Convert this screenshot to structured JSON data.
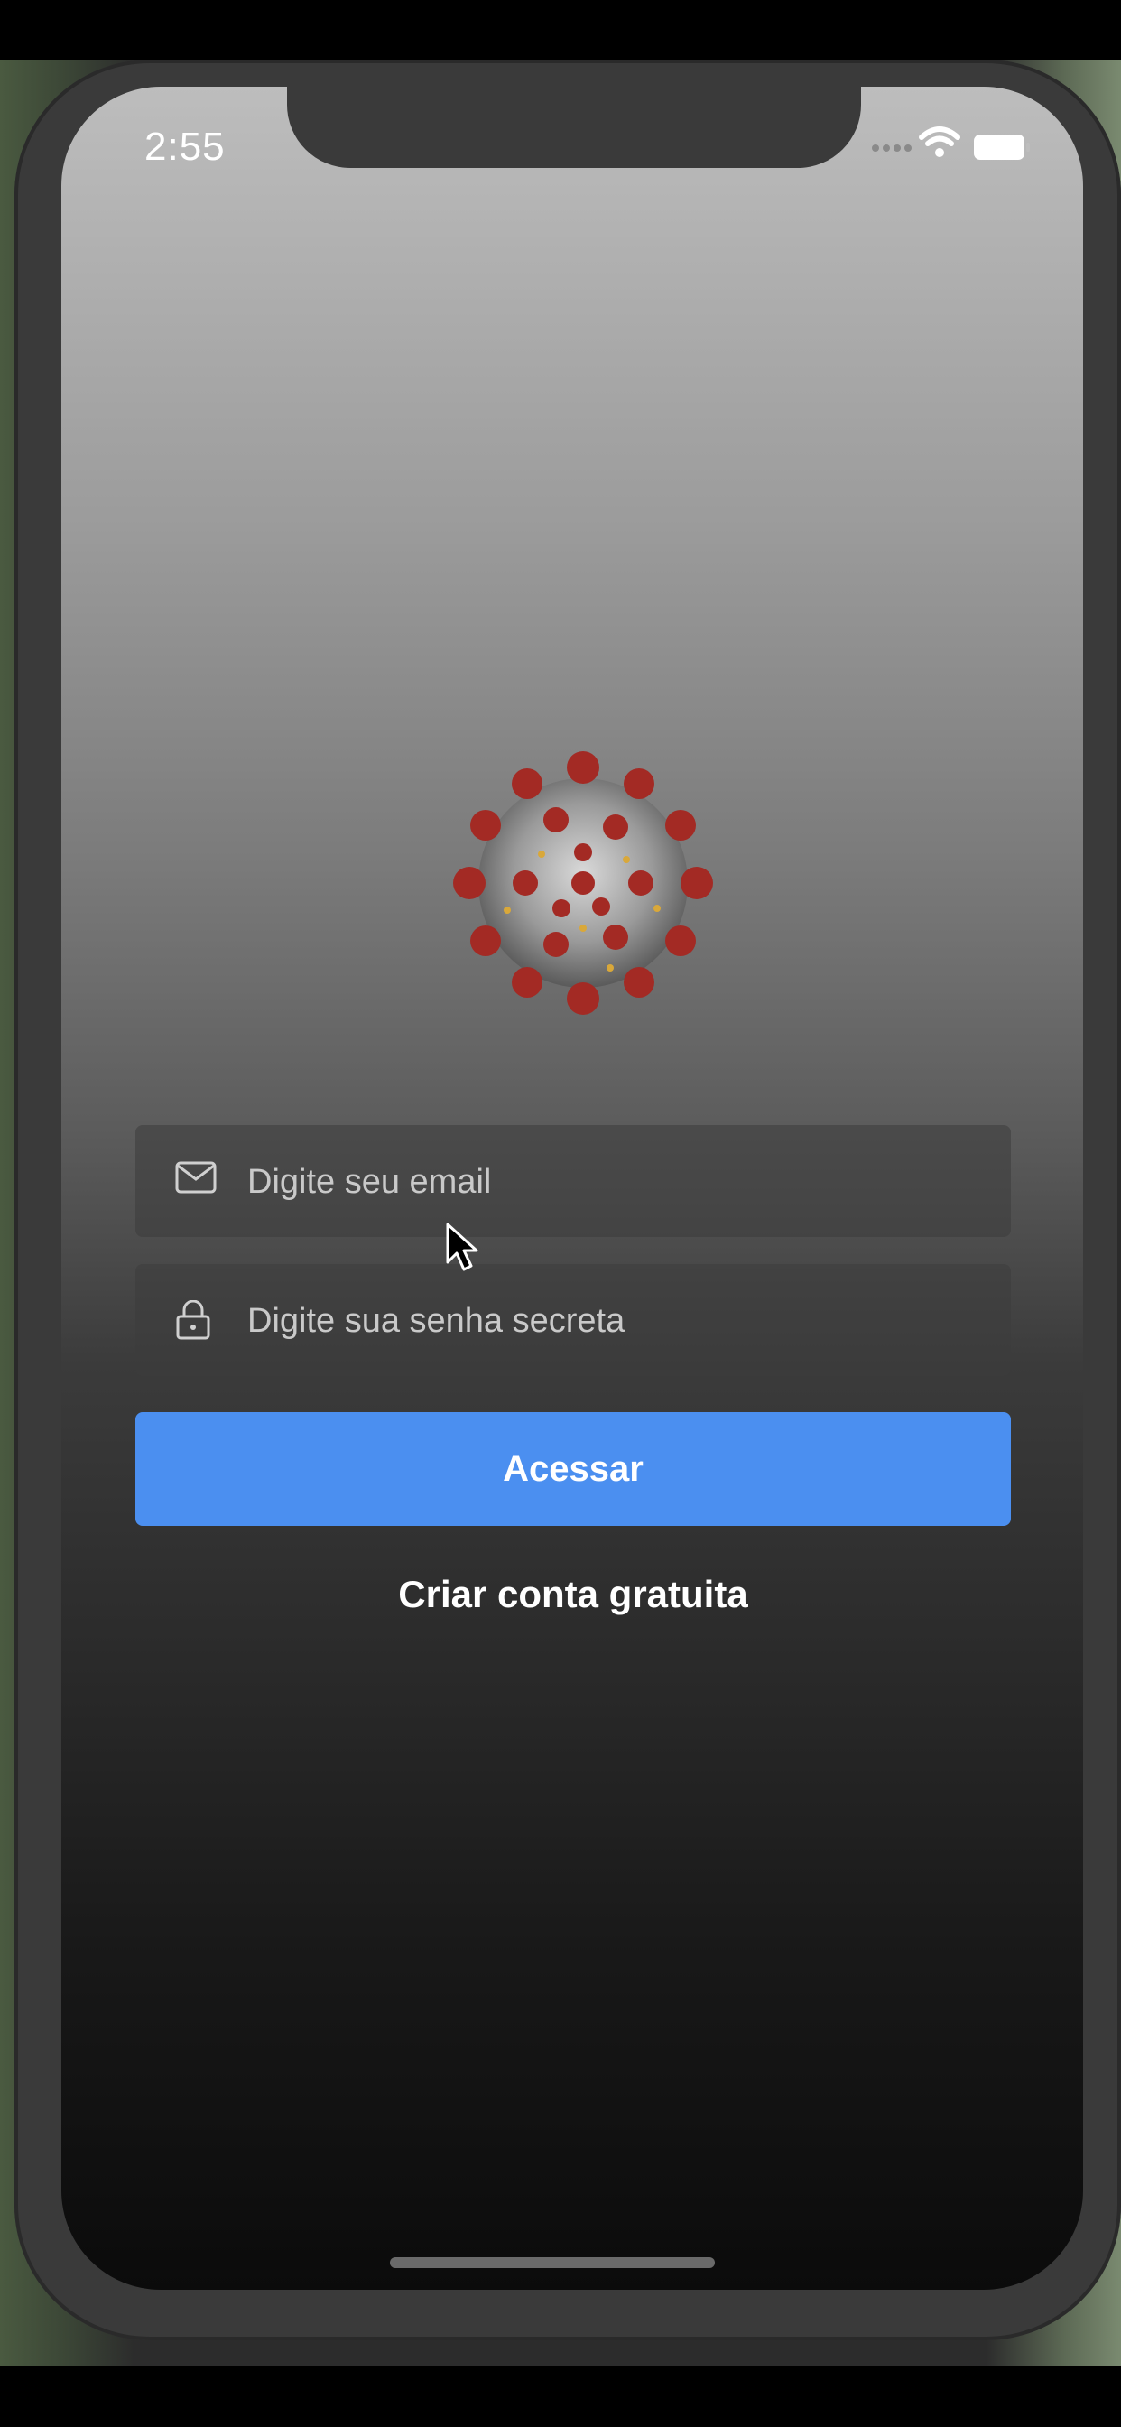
{
  "status_bar": {
    "time": "2:55"
  },
  "login": {
    "email_placeholder": "Digite seu email",
    "password_placeholder": "Digite sua senha secreta",
    "submit_label": "Acessar",
    "create_account_label": "Criar conta gratuita"
  },
  "icons": {
    "email": "mail-icon",
    "password": "lock-icon",
    "logo": "virus-logo"
  },
  "colors": {
    "accent": "#4b8ff0",
    "background_top": "#bdbdbd",
    "background_bottom": "#0b0b0b"
  }
}
